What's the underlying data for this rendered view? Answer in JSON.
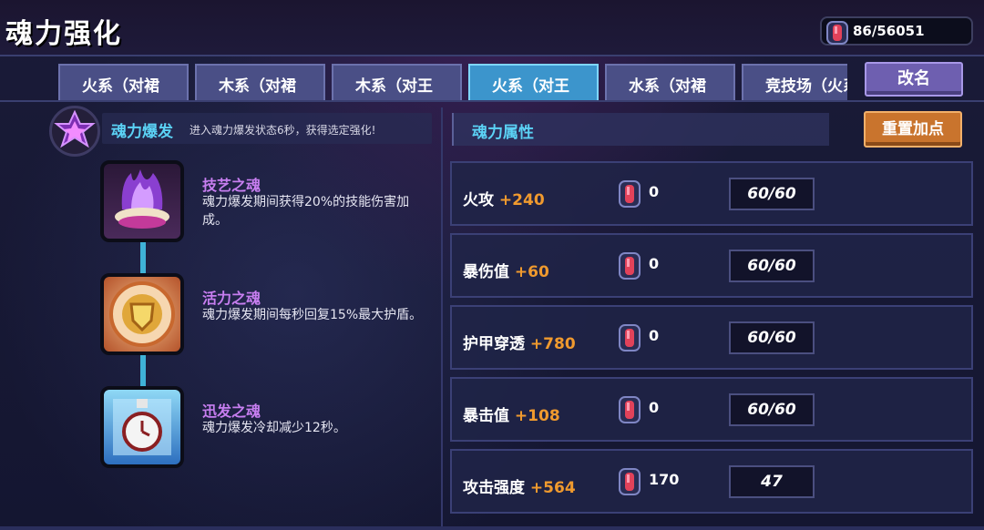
{
  "header": {
    "title": "魂力强化",
    "currency": "86/56051"
  },
  "tabs": [
    {
      "label": "火系（对裙",
      "active": false
    },
    {
      "label": "木系（对裙",
      "active": false
    },
    {
      "label": "木系（对王",
      "active": false
    },
    {
      "label": "火系（对王",
      "active": true
    },
    {
      "label": "水系（对裙",
      "active": false
    },
    {
      "label": "竞技场（火系",
      "active": false
    }
  ],
  "buttons": {
    "rename": "改名",
    "reset": "重置加点"
  },
  "soul_burst": {
    "title": "魂力爆发",
    "desc": "进入魂力爆发状态6秒，获得选定强化!"
  },
  "souls": [
    {
      "name": "技艺之魂",
      "desc": "魂力爆发期间获得20%的技能伤害加成。",
      "icon": "purple-flame-shell-icon"
    },
    {
      "name": "活力之魂",
      "desc": "魂力爆发期间每秒回复15%最大护盾。",
      "icon": "golden-shield-icon"
    },
    {
      "name": "迅发之魂",
      "desc": "魂力爆发冷却减少12秒。",
      "icon": "blue-clock-icon"
    }
  ],
  "attributes": {
    "title": "魂力属性",
    "rows": [
      {
        "label": "火攻",
        "bonus": "+240",
        "count": "0",
        "value": "60/60"
      },
      {
        "label": "暴伤值",
        "bonus": "+60",
        "count": "0",
        "value": "60/60"
      },
      {
        "label": "护甲穿透",
        "bonus": "+780",
        "count": "0",
        "value": "60/60"
      },
      {
        "label": "暴击值",
        "bonus": "+108",
        "count": "0",
        "value": "60/60"
      },
      {
        "label": "攻击强度",
        "bonus": "+564",
        "count": "170",
        "value": "47"
      }
    ]
  },
  "colors": {
    "accent": "#5bd2f5",
    "bonus": "#f09a2e",
    "soul_name": "#c77ef0",
    "active_tab": "#3c95cc"
  }
}
